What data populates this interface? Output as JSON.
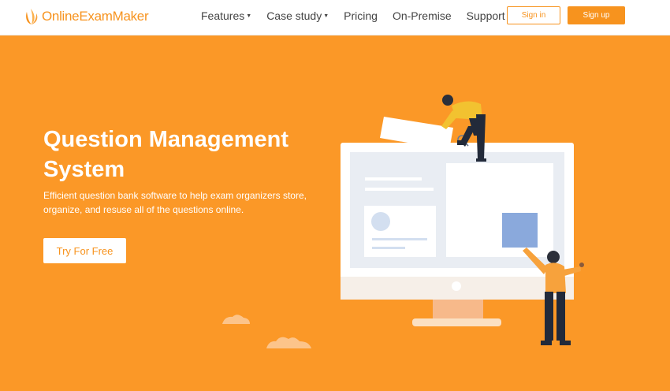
{
  "brand": {
    "name": "OnlineExamMaker",
    "color": "#f7931e"
  },
  "nav": [
    {
      "label": "Features",
      "dropdown": true
    },
    {
      "label": "Case study",
      "dropdown": true
    },
    {
      "label": "Pricing",
      "dropdown": false
    },
    {
      "label": "On-Premise",
      "dropdown": false
    },
    {
      "label": "Support",
      "dropdown": true
    }
  ],
  "auth": {
    "signin_label": "Sign in",
    "signup_label": "Sign up"
  },
  "hero": {
    "title": "Question Management System",
    "subtitle": "Efficient question bank software to help exam organizers store, organize, and resuse all of the questions online.",
    "cta_label": "Try For Free",
    "background": "#fb9827"
  }
}
